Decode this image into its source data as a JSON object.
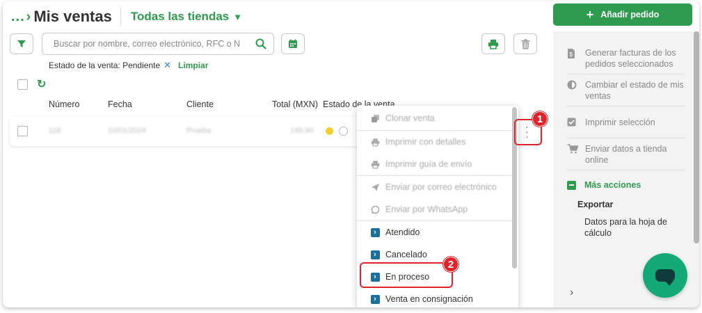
{
  "header": {
    "breadcrumb": "...",
    "title": "Mis ventas",
    "store_selector": "Todas las tiendas"
  },
  "toolbar": {
    "search_placeholder": "Buscar por nombre, correo electrónico, RFC o N",
    "icons": [
      "filter-icon",
      "search-icon",
      "calendar-icon",
      "print-icon",
      "trash-icon"
    ]
  },
  "filters": {
    "active_filter": "Estado de la venta: Pendiente",
    "clear_label": "Limpiar"
  },
  "table": {
    "columns": [
      "Número",
      "Fecha",
      "Cliente",
      "Total (MXN)",
      "Estado de la venta"
    ],
    "rows": [
      {
        "numero": "118",
        "fecha": "10/01/2024",
        "cliente": "Prueba",
        "total": "199.90"
      }
    ]
  },
  "row_menu": {
    "disabled_items": [
      {
        "label": "Clonar venta",
        "icon": "clone-icon"
      },
      {
        "label": "Imprimir con detalles",
        "icon": "print-icon"
      },
      {
        "label": "Imprimir guía de envío",
        "icon": "print-icon"
      },
      {
        "label": "Enviar por correo electrónico",
        "icon": "send-icon"
      },
      {
        "label": "Enviar por WhatsApp",
        "icon": "whatsapp-icon"
      }
    ],
    "status_items": [
      "Atendido",
      "Cancelado",
      "En proceso",
      "Venta en consignación"
    ]
  },
  "annotations": {
    "step1": "1",
    "step2": "2"
  },
  "sidebar": {
    "add_button": "Añadir pedido",
    "items": [
      {
        "label": "Generar facturas de los pedidos seleccionados",
        "icon": "invoice-icon"
      },
      {
        "label": "Cambiar el estado de mis ventas",
        "icon": "half-circle-icon"
      },
      {
        "label": "Imprimir selección",
        "icon": "checkbox-icon"
      },
      {
        "label": "Enviar datos a tienda online",
        "icon": "cart-icon"
      }
    ],
    "more_actions": "Más acciones",
    "export_heading": "Exportar",
    "export_item": "Datos para la hoja de cálculo"
  },
  "colors": {
    "brand_green": "#2e9b4f",
    "highlight_red": "#e0232a",
    "status_chevron": "#1d6f9e",
    "chat_bubble": "#16a978"
  }
}
